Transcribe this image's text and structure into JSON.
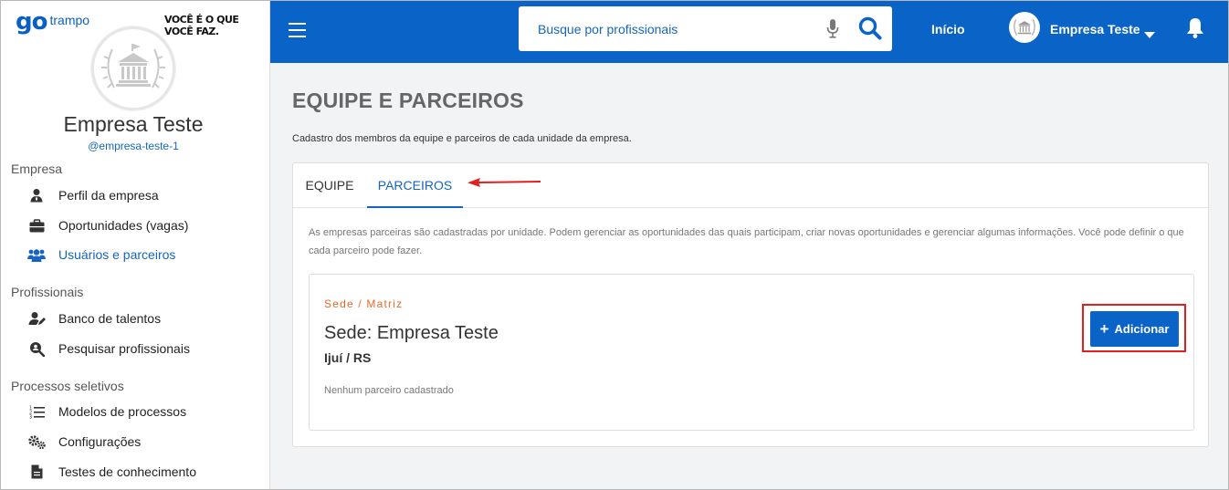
{
  "brand": {
    "logo_go": "go",
    "logo_trampo": "trampo",
    "slogan": "VOCÊ É O QUE VOCÊ FAZ."
  },
  "profile": {
    "name": "Empresa Teste",
    "handle": "@empresa-teste-1"
  },
  "sidebar": {
    "sections": [
      {
        "title": "Empresa",
        "items": [
          {
            "label": "Perfil da empresa",
            "icon": "user-tie-icon"
          },
          {
            "label": "Oportunidades (vagas)",
            "icon": "briefcase-icon"
          },
          {
            "label": "Usuários e parceiros",
            "icon": "users-icon",
            "active": true
          }
        ]
      },
      {
        "title": "Profissionais",
        "items": [
          {
            "label": "Banco de talentos",
            "icon": "user-edit-icon"
          },
          {
            "label": "Pesquisar profissionais",
            "icon": "search-user-icon"
          }
        ]
      },
      {
        "title": "Processos seletivos",
        "items": [
          {
            "label": "Modelos de processos",
            "icon": "list-ordered-icon"
          },
          {
            "label": "Configurações",
            "icon": "gears-icon"
          },
          {
            "label": "Testes de conhecimento",
            "icon": "document-icon"
          }
        ]
      }
    ]
  },
  "header": {
    "search_placeholder": "Busque por profissionais",
    "home_label": "Início",
    "company_label": "Empresa Teste"
  },
  "main": {
    "title": "EQUIPE E PARCEIROS",
    "description": "Cadastro dos membros da equipe e parceiros de cada unidade da empresa.",
    "tabs": [
      {
        "label": "EQUIPE",
        "active": false
      },
      {
        "label": "PARCEIROS",
        "active": true
      }
    ],
    "info": "As empresas parceiras são cadastradas por unidade. Podem gerenciar as oportunidades das quais participam, criar novas oportunidades e gerenciar algumas informações. Você pode definir o que cada parceiro pode fazer.",
    "unit": {
      "tag": "Sede / Matriz",
      "name": "Sede: Empresa Teste",
      "city": "Ijuí / RS",
      "empty": "Nenhum parceiro cadastrado",
      "add_label": "Adicionar"
    }
  },
  "colors": {
    "primary": "#0a64c8",
    "accent_orange": "#e8692a",
    "annotation_red": "#e41e1e"
  }
}
